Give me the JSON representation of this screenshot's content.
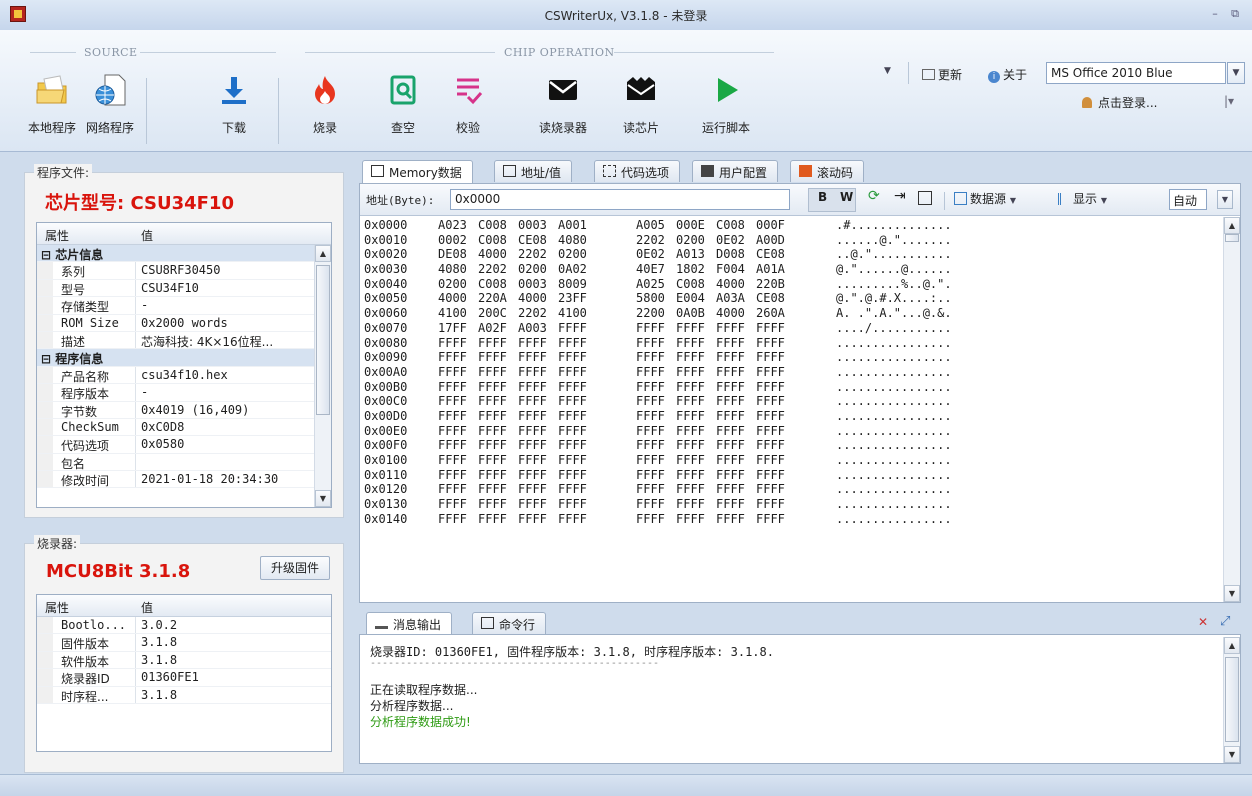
{
  "window": {
    "title": "CSWriterUx, V3.1.8 - 未登录",
    "min_glyph": "–",
    "restore_glyph": "⧉"
  },
  "ribbon": {
    "groups": {
      "source": "SOURCE",
      "chip_operation": "CHIP OPERATION"
    },
    "buttons": {
      "local_program": "本地程序",
      "network_program": "网络程序",
      "download": "下载",
      "burn": "烧录",
      "blank_check": "查空",
      "verify": "校验",
      "read_programmer": "读烧录器",
      "read_chip": "读芯片",
      "run_script": "运行脚本"
    },
    "right": {
      "update": "更新",
      "about": "关于",
      "theme": "MS Office 2010 Blue",
      "login": "点击登录..."
    }
  },
  "program_file": {
    "caption": "程序文件:",
    "chip_model": "芯片型号: CSU34F10",
    "headers": {
      "prop": "属性",
      "value": "值"
    },
    "categories": {
      "chip": "芯片信息",
      "program": "程序信息"
    },
    "chip_rows": [
      {
        "k": "系列",
        "v": "CSU8RF30450"
      },
      {
        "k": "型号",
        "v": "CSU34F10"
      },
      {
        "k": "存储类型",
        "v": "-"
      },
      {
        "k": "ROM Size",
        "v": "0x2000 words"
      },
      {
        "k": "描述",
        "v": "芯海科技: 4K×16位程..."
      }
    ],
    "program_rows": [
      {
        "k": "产品名称",
        "v": "csu34f10.hex"
      },
      {
        "k": "程序版本",
        "v": "-"
      },
      {
        "k": "字节数",
        "v": "0x4019 (16,409)"
      },
      {
        "k": "CheckSum",
        "v": "0xC0D8"
      },
      {
        "k": "代码选项",
        "v": "0x0580"
      },
      {
        "k": "包名",
        "v": ""
      },
      {
        "k": "修改时间",
        "v": "2021-01-18 20:34:30"
      }
    ]
  },
  "programmer": {
    "caption": "烧录器:",
    "model": "MCU8Bit 3.1.8",
    "upgrade_button": "升级固件",
    "headers": {
      "prop": "属性",
      "value": "值"
    },
    "rows": [
      {
        "k": "Bootlo...",
        "v": "3.0.2"
      },
      {
        "k": "固件版本",
        "v": "3.1.8"
      },
      {
        "k": "软件版本",
        "v": "3.1.8"
      },
      {
        "k": "烧录器ID",
        "v": "01360FE1"
      },
      {
        "k": "时序程...",
        "v": "3.1.8"
      }
    ]
  },
  "tabs": [
    "Memory数据",
    "地址/值",
    "代码选项",
    "用户配置",
    "滚动码"
  ],
  "mem_toolbar": {
    "addr_label": "地址(Byte):",
    "addr_value": "0x0000",
    "b": "B",
    "w": "W",
    "data_source": "数据源",
    "display": "显示",
    "auto": "自动"
  },
  "hex_rows": [
    {
      "addr": "0x0000",
      "w": [
        "A023",
        "C008",
        "0003",
        "A001",
        "A005",
        "000E",
        "C008",
        "000F"
      ],
      "a": ".#.............."
    },
    {
      "addr": "0x0010",
      "w": [
        "0002",
        "C008",
        "CE08",
        "4080",
        "2202",
        "0200",
        "0E02",
        "A00D"
      ],
      "a": "......@.\"......."
    },
    {
      "addr": "0x0020",
      "w": [
        "DE08",
        "4000",
        "2202",
        "0200",
        "0E02",
        "A013",
        "D008",
        "CE08"
      ],
      "a": "..@.\"..........."
    },
    {
      "addr": "0x0030",
      "w": [
        "4080",
        "2202",
        "0200",
        "0A02",
        "40E7",
        "1802",
        "F004",
        "A01A"
      ],
      "a": "@.\"......@......"
    },
    {
      "addr": "0x0040",
      "w": [
        "0200",
        "C008",
        "0003",
        "8009",
        "A025",
        "C008",
        "4000",
        "220B"
      ],
      "a": ".........%..@.\"."
    },
    {
      "addr": "0x0050",
      "w": [
        "4000",
        "220A",
        "4000",
        "23FF",
        "5800",
        "E004",
        "A03A",
        "CE08"
      ],
      "a": "@.\".@.#.X....:.."
    },
    {
      "addr": "0x0060",
      "w": [
        "4100",
        "200C",
        "2202",
        "4100",
        "2200",
        "0A0B",
        "4000",
        "260A"
      ],
      "a": "A. .\".A.\"...@.&."
    },
    {
      "addr": "0x0070",
      "w": [
        "17FF",
        "A02F",
        "A003",
        "FFFF",
        "FFFF",
        "FFFF",
        "FFFF",
        "FFFF"
      ],
      "a": "..../..........."
    },
    {
      "addr": "0x0080",
      "w": [
        "FFFF",
        "FFFF",
        "FFFF",
        "FFFF",
        "FFFF",
        "FFFF",
        "FFFF",
        "FFFF"
      ],
      "a": "................"
    },
    {
      "addr": "0x0090",
      "w": [
        "FFFF",
        "FFFF",
        "FFFF",
        "FFFF",
        "FFFF",
        "FFFF",
        "FFFF",
        "FFFF"
      ],
      "a": "................"
    },
    {
      "addr": "0x00A0",
      "w": [
        "FFFF",
        "FFFF",
        "FFFF",
        "FFFF",
        "FFFF",
        "FFFF",
        "FFFF",
        "FFFF"
      ],
      "a": "................"
    },
    {
      "addr": "0x00B0",
      "w": [
        "FFFF",
        "FFFF",
        "FFFF",
        "FFFF",
        "FFFF",
        "FFFF",
        "FFFF",
        "FFFF"
      ],
      "a": "................"
    },
    {
      "addr": "0x00C0",
      "w": [
        "FFFF",
        "FFFF",
        "FFFF",
        "FFFF",
        "FFFF",
        "FFFF",
        "FFFF",
        "FFFF"
      ],
      "a": "................"
    },
    {
      "addr": "0x00D0",
      "w": [
        "FFFF",
        "FFFF",
        "FFFF",
        "FFFF",
        "FFFF",
        "FFFF",
        "FFFF",
        "FFFF"
      ],
      "a": "................"
    },
    {
      "addr": "0x00E0",
      "w": [
        "FFFF",
        "FFFF",
        "FFFF",
        "FFFF",
        "FFFF",
        "FFFF",
        "FFFF",
        "FFFF"
      ],
      "a": "................"
    },
    {
      "addr": "0x00F0",
      "w": [
        "FFFF",
        "FFFF",
        "FFFF",
        "FFFF",
        "FFFF",
        "FFFF",
        "FFFF",
        "FFFF"
      ],
      "a": "................"
    },
    {
      "addr": "0x0100",
      "w": [
        "FFFF",
        "FFFF",
        "FFFF",
        "FFFF",
        "FFFF",
        "FFFF",
        "FFFF",
        "FFFF"
      ],
      "a": "................"
    },
    {
      "addr": "0x0110",
      "w": [
        "FFFF",
        "FFFF",
        "FFFF",
        "FFFF",
        "FFFF",
        "FFFF",
        "FFFF",
        "FFFF"
      ],
      "a": "................"
    },
    {
      "addr": "0x0120",
      "w": [
        "FFFF",
        "FFFF",
        "FFFF",
        "FFFF",
        "FFFF",
        "FFFF",
        "FFFF",
        "FFFF"
      ],
      "a": "................"
    },
    {
      "addr": "0x0130",
      "w": [
        "FFFF",
        "FFFF",
        "FFFF",
        "FFFF",
        "FFFF",
        "FFFF",
        "FFFF",
        "FFFF"
      ],
      "a": "................"
    },
    {
      "addr": "0x0140",
      "w": [
        "FFFF",
        "FFFF",
        "FFFF",
        "FFFF",
        "FFFF",
        "FFFF",
        "FFFF",
        "FFFF"
      ],
      "a": "................"
    }
  ],
  "output_tabs": [
    "消息输出",
    "命令行"
  ],
  "messages": {
    "line1": "烧录器ID: 01360FE1, 固件程序版本: 3.1.8, 时序程序版本: 3.1.8.",
    "divider": "------------------------------------------------",
    "line2": "正在读取程序数据...",
    "line3": "分析程序数据...",
    "line4": "分析程序数据成功!",
    "success_color": "#2e9b13"
  },
  "colors": {
    "accent_red": "#d9140c",
    "ribbon_bg": "#dbe6f3"
  }
}
